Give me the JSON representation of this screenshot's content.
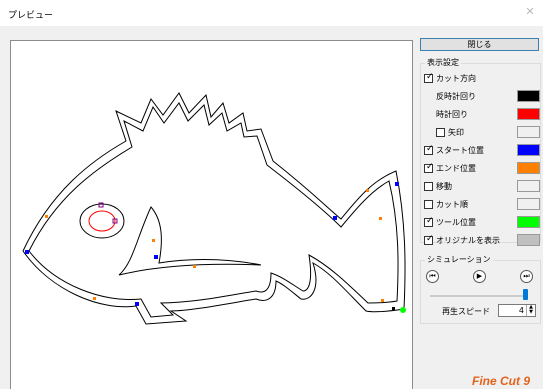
{
  "window": {
    "title": "プレビュー"
  },
  "panel": {
    "close_label": "閉じる",
    "display_settings": {
      "legend": "表示設定",
      "cut_direction": {
        "label": "カット方向",
        "checked": true
      },
      "ccw": {
        "label": "反時計回り",
        "color": "#000000"
      },
      "cw": {
        "label": "時計回り",
        "color": "#ff0000"
      },
      "arrow": {
        "label": "矢印",
        "checked": false,
        "color": "#f0f0f0"
      },
      "start_pos": {
        "label": "スタート位置",
        "checked": true,
        "color": "#0000ff"
      },
      "end_pos": {
        "label": "エンド位置",
        "checked": true,
        "color": "#ff8000"
      },
      "move": {
        "label": "移動",
        "checked": false,
        "color": "#f0f0f0"
      },
      "cut_order": {
        "label": "カット順",
        "checked": false,
        "color": "#f0f0f0"
      },
      "tool_pos": {
        "label": "ツール位置",
        "checked": true,
        "color": "#00ff00"
      },
      "show_original": {
        "label": "オリジナルを表示",
        "checked": true,
        "color": "#c0c0c0"
      }
    },
    "simulation": {
      "legend": "シミュレーション",
      "speed_label": "再生スピード",
      "speed_value": "4",
      "slider_level": 1.0
    }
  },
  "logo_text": "Fine Cut 9",
  "colors": {
    "accent": "#0078d7",
    "start_marker": "#0000ff",
    "end_marker": "#ff8000",
    "tool_marker": "#00ff00",
    "cut_cw": "#ff0000",
    "cut_ccw": "#000000"
  }
}
